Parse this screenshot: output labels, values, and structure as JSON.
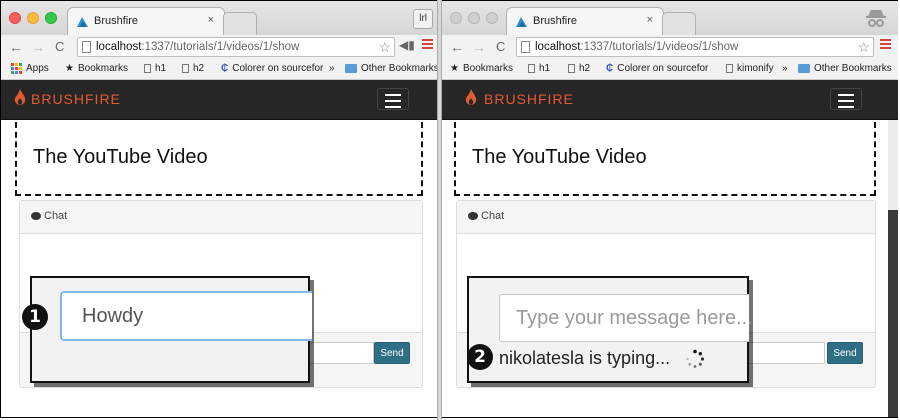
{
  "left": {
    "tab": {
      "title": "Brushfire",
      "close": "×"
    },
    "profile_button": "lrl",
    "url": {
      "host": "localhost",
      "rest": ":1337/tutorials/1/videos/1/show"
    },
    "bookmarks": [
      "Apps",
      "Bookmarks",
      "h1",
      "h2",
      "Colorer on sourcefor",
      "»",
      "Other Bookmarks"
    ],
    "brand": "BRUSHFIRE",
    "video_title": "The YouTube Video",
    "chat_label": "Chat",
    "send_label": "Send",
    "callout": {
      "number": "1",
      "input_value": "Howdy"
    }
  },
  "right": {
    "tab": {
      "title": "Brushfire",
      "close": "×"
    },
    "url": {
      "host": "localhost",
      "rest": ":1337/tutorials/1/videos/1/show"
    },
    "bookmarks": [
      "Bookmarks",
      "h1",
      "h2",
      "Colorer on sourcefor",
      "kimonify",
      "»",
      "Other Bookmarks"
    ],
    "brand": "BRUSHFIRE",
    "video_title": "The YouTube Video",
    "chat_label": "Chat",
    "send_label": "Send",
    "callout": {
      "number": "2",
      "input_placeholder": "Type your message here...",
      "typing_status": "nikolatesla is typing..."
    }
  },
  "colors": {
    "brand": "#e35b33",
    "navbar": "#262626",
    "send_button": "#2f6f86"
  }
}
